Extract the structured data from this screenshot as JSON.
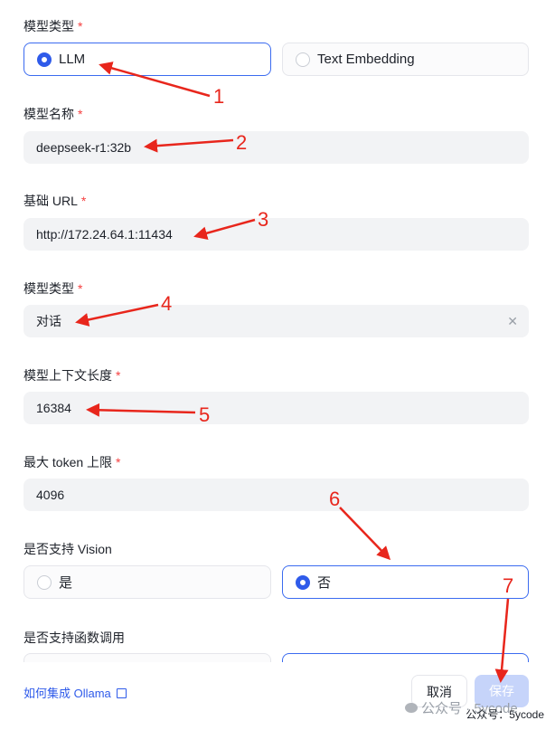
{
  "form": {
    "required_mark": "*",
    "model_kind": {
      "label": "模型类型",
      "options": [
        "LLM",
        "Text Embedding"
      ],
      "selected": "LLM"
    },
    "model_name": {
      "label": "模型名称",
      "value": "deepseek-r1:32b"
    },
    "base_url": {
      "label": "基础 URL",
      "value": "http://172.24.64.1:11434"
    },
    "model_type": {
      "label": "模型类型",
      "value": "对话",
      "clear_icon": "clear-icon"
    },
    "context_length": {
      "label": "模型上下文长度",
      "value": "16384"
    },
    "max_tokens": {
      "label": "最大 token 上限",
      "value": "4096"
    },
    "vision": {
      "label": "是否支持 Vision",
      "options": [
        "是",
        "否"
      ],
      "selected": "否"
    },
    "function_call": {
      "label": "是否支持函数调用"
    }
  },
  "footer": {
    "link": "如何集成 Ollama",
    "link_icon": "external-link-icon",
    "cancel": "取消",
    "save": "保存"
  },
  "annotations": [
    "1",
    "2",
    "3",
    "4",
    "5",
    "6",
    "7"
  ],
  "watermark": {
    "wechat": "公众号 · 5ycode",
    "bottom": "公众号：5ycode"
  },
  "colors": {
    "accent": "#2f5bea",
    "required": "#f53f3f",
    "annotation": "#e8261c",
    "input_bg": "#f2f3f5"
  }
}
